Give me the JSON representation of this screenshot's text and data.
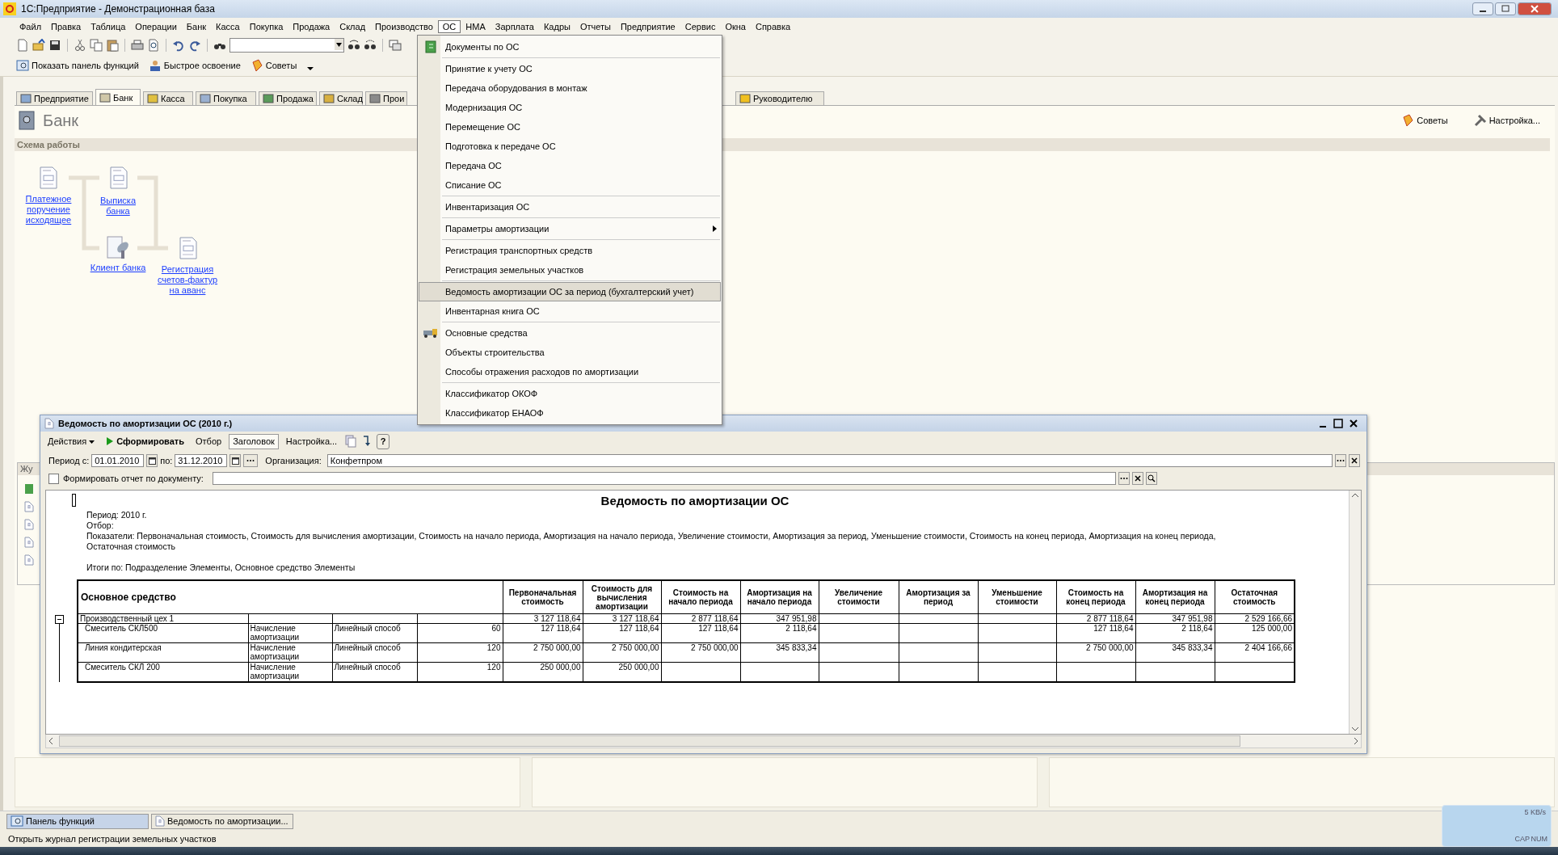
{
  "window": {
    "title": "1С:Предприятие - Демонстрационная база"
  },
  "menu_bar": [
    {
      "label": "Файл",
      "selected": false
    },
    {
      "label": "Правка",
      "selected": false
    },
    {
      "label": "Таблица",
      "selected": false
    },
    {
      "label": "Операции",
      "selected": false
    },
    {
      "label": "Банк",
      "selected": false
    },
    {
      "label": "Касса",
      "selected": false
    },
    {
      "label": "Покупка",
      "selected": false
    },
    {
      "label": "Продажа",
      "selected": false
    },
    {
      "label": "Склад",
      "selected": false
    },
    {
      "label": "Производство",
      "selected": false
    },
    {
      "label": "ОС",
      "selected": true
    },
    {
      "label": "НМА",
      "selected": false
    },
    {
      "label": "Зарплата",
      "selected": false
    },
    {
      "label": "Кадры",
      "selected": false
    },
    {
      "label": "Отчеты",
      "selected": false
    },
    {
      "label": "Предприятие",
      "selected": false
    },
    {
      "label": "Сервис",
      "selected": false
    },
    {
      "label": "Окна",
      "selected": false
    },
    {
      "label": "Справка",
      "selected": false
    }
  ],
  "function_bar": [
    {
      "label": "Показать панель функций",
      "kind": "panel"
    },
    {
      "label": "Быстрое освоение",
      "kind": "learning"
    },
    {
      "label": "Советы",
      "kind": "tips"
    }
  ],
  "tabs": [
    {
      "label": "Предприятие",
      "selected": false
    },
    {
      "label": "Банк",
      "selected": true
    },
    {
      "label": "Касса",
      "selected": false
    },
    {
      "label": "Покупка",
      "selected": false
    },
    {
      "label": "Продажа",
      "selected": false
    },
    {
      "label": "Склад",
      "selected": false
    },
    {
      "label": "Прои",
      "selected": false
    },
    {
      "label": "Руководителю",
      "selected": false
    }
  ],
  "page": {
    "title": "Банк",
    "section": "Схема работы",
    "actions": [
      {
        "label": "Советы"
      },
      {
        "label": "Настройка..."
      }
    ]
  },
  "scheme": {
    "items": [
      {
        "label": "Платежное поручение исходящее",
        "kind": "document"
      },
      {
        "label": "Выписка банка",
        "kind": "document"
      },
      {
        "label": "Клиент банка",
        "kind": "client"
      },
      {
        "label": "Регистрация счетов-фактур на аванс",
        "kind": "document"
      }
    ]
  },
  "journal_panel": {
    "title": "Жу"
  },
  "os_menu": {
    "groups": [
      {
        "items": [
          {
            "label": "Документы по ОС",
            "kind": "document",
            "selected": false
          }
        ]
      },
      {
        "items": [
          {
            "label": "Принятие к учету ОС",
            "kind": "plain",
            "selected": false
          },
          {
            "label": "Передача оборудования в монтаж",
            "kind": "plain",
            "selected": false
          },
          {
            "label": "Модернизация ОС",
            "kind": "plain",
            "selected": false
          },
          {
            "label": "Перемещение ОС",
            "kind": "plain",
            "selected": false
          },
          {
            "label": "Подготовка к передаче ОС",
            "kind": "plain",
            "selected": false
          },
          {
            "label": "Передача ОС",
            "kind": "plain",
            "selected": false
          },
          {
            "label": "Списание ОС",
            "kind": "plain",
            "selected": false
          }
        ]
      },
      {
        "items": [
          {
            "label": "Инвентаризация ОС",
            "kind": "plain",
            "selected": false
          }
        ]
      },
      {
        "items": [
          {
            "label": "Параметры амортизации",
            "kind": "submenu",
            "selected": false
          }
        ]
      },
      {
        "items": [
          {
            "label": "Регистрация транспортных средств",
            "kind": "plain",
            "selected": false
          },
          {
            "label": "Регистрация земельных участков",
            "kind": "plain",
            "selected": false
          }
        ]
      },
      {
        "items": [
          {
            "label": "Ведомость амортизации ОС за период (бухгалтерский учет)",
            "kind": "plain",
            "selected": true
          },
          {
            "label": "Инвентарная книга ОС",
            "kind": "plain",
            "selected": false
          }
        ]
      },
      {
        "items": [
          {
            "label": "Основные средства",
            "kind": "vehicle",
            "selected": false
          },
          {
            "label": "Объекты строительства",
            "kind": "plain",
            "selected": false
          },
          {
            "label": "Способы отражения расходов по амортизации",
            "kind": "plain",
            "selected": false
          }
        ]
      },
      {
        "items": [
          {
            "label": "Классификатор ОКОФ",
            "kind": "plain",
            "selected": false
          },
          {
            "label": "Классификатор ЕНАОФ",
            "kind": "plain",
            "selected": false
          }
        ]
      }
    ]
  },
  "report_window": {
    "title": "Ведомость по амортизации ОС (2010 г.)",
    "toolbar": [
      {
        "label": "Действия",
        "kind": "menu",
        "pressed": false
      },
      {
        "label": "Сформировать",
        "kind": "run",
        "pressed": false
      },
      {
        "label": "Отбор",
        "kind": "plain",
        "pressed": false
      },
      {
        "label": "Заголовок",
        "kind": "plain",
        "pressed": true
      },
      {
        "label": "Настройка...",
        "kind": "plain",
        "pressed": false
      },
      {
        "label": "?",
        "kind": "help",
        "pressed": false
      }
    ],
    "params": {
      "period_from_label": "Период с:",
      "period_from": "01.01.2010",
      "period_to_label": "по:",
      "period_to": "31.12.2010",
      "org_label": "Организация:",
      "org": "Конфетпром",
      "by_document_label": "Формировать отчет по документу:",
      "by_document_checked": false
    },
    "report": {
      "heading": "Ведомость по амортизации ОС",
      "lines": [
        "Период: 2010 г.",
        "Отбор:",
        "Показатели:  Первоначальная стоимость, Стоимость для вычисления амортизации, Стоимость на начало периода, Амортизация на начало периода, Увеличение стоимости, Амортизация за период, Уменьшение стоимости, Стоимость на конец периода, Амортизация на конец периода, Остаточная стоимость",
        "Итоги по:  Подразделение Элементы, Основное средство Элементы"
      ],
      "table": {
        "asset_header": "Основное средство",
        "value_columns": [
          "Первоначальная стоимость",
          "Стоимость для вычисления амортизации",
          "Стоимость на начало периода",
          "Амортизация на начало периода",
          "Увеличение стоимости",
          "Амортизация за период",
          "Уменьшение стоимости",
          "Стоимость на конец периода",
          "Амортизация на конец периода",
          "Остаточная стоимость"
        ],
        "rows": [
          {
            "kind": "group",
            "expanded": true,
            "asset": "Производственный цех 1",
            "column_5": "3 127 118,64",
            "column_6": "3 127 118,64",
            "column_7": "2 877 118,64",
            "column_8": "347 951,98",
            "column_12": "2 877 118,64",
            "column_13": "347 951,98",
            "column_14": "2 529 166,66"
          },
          {
            "kind": "item",
            "asset": "Смеситель СКЛ500",
            "column_2": "Начисление амортизации",
            "column_3": "Линейный способ",
            "column_4": "60",
            "column_5": "127 118,64",
            "column_6": "127 118,64",
            "column_7": "127 118,64",
            "column_8": "2 118,64",
            "column_12": "127 118,64",
            "column_13": "2 118,64",
            "column_14": "125 000,00"
          },
          {
            "kind": "item",
            "asset": "Линия кондитерская",
            "column_2": "Начисление амортизации",
            "column_3": "Линейный способ",
            "column_4": "120",
            "column_5": "2 750 000,00",
            "column_6": "2 750 000,00",
            "column_7": "2 750 000,00",
            "column_8": "345 833,34",
            "column_12": "2 750 000,00",
            "column_13": "345 833,34",
            "column_14": "2 404 166,66"
          },
          {
            "kind": "item",
            "asset": "Смеситель СКЛ 200",
            "column_2": "Начисление амортизации",
            "column_3": "Линейный способ",
            "column_4": "120",
            "column_5": "250 000,00",
            "column_6": "250 000,00"
          }
        ]
      }
    }
  },
  "window_bar": [
    {
      "label": "Панель функций",
      "selected": true
    },
    {
      "label": "Ведомость по амортизации...",
      "selected": false
    }
  ],
  "status_bar": {
    "text": "Открыть журнал регистрации земельных участков"
  },
  "tray": {
    "speed": "5 KB/s",
    "caps": "CAP",
    "num": "NUM"
  }
}
